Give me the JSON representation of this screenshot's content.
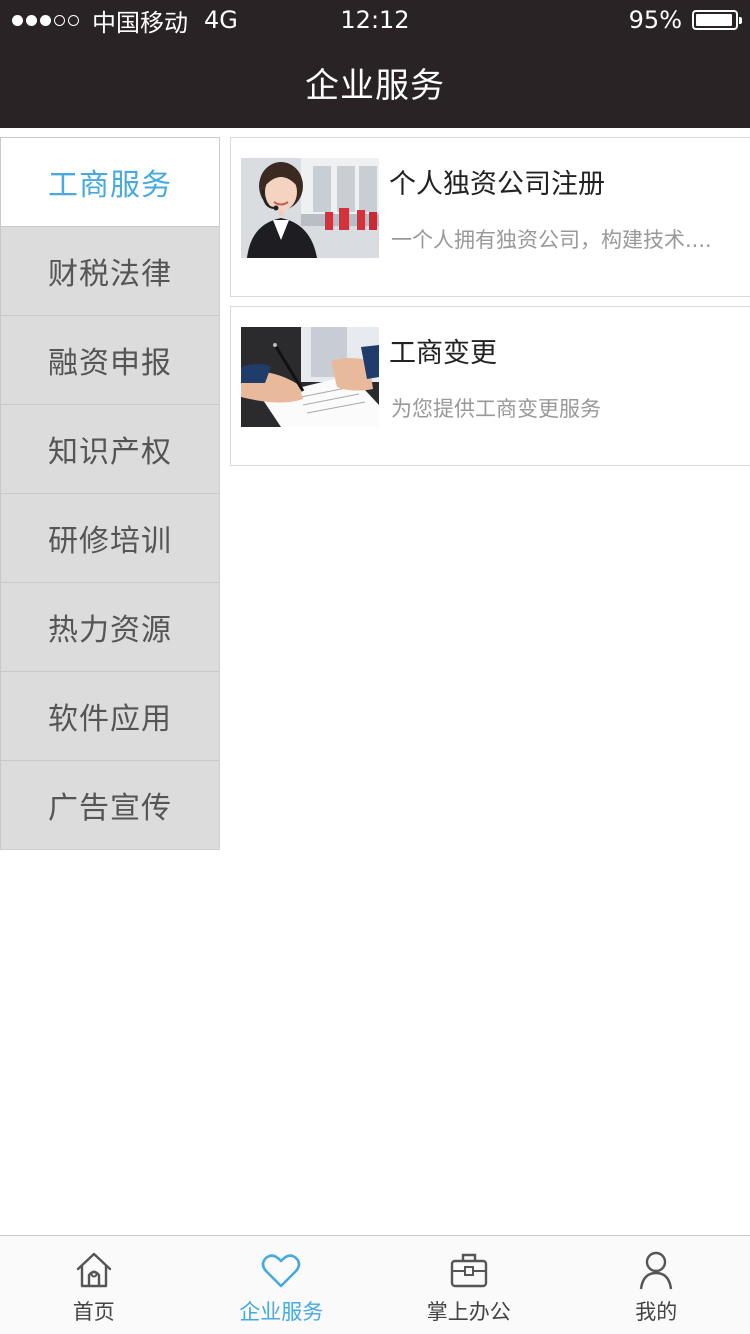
{
  "status_bar": {
    "carrier": "中国移动",
    "network": "4G",
    "time": "12:12",
    "battery": "95%",
    "battery_level": 0.95,
    "signal_bars": 3,
    "signal_total": 5
  },
  "nav": {
    "title": "企业服务"
  },
  "side_menu": {
    "items": [
      {
        "label": "工商服务",
        "active": true
      },
      {
        "label": "财税法律",
        "active": false
      },
      {
        "label": "融资申报",
        "active": false
      },
      {
        "label": "知识产权",
        "active": false
      },
      {
        "label": "研修培训",
        "active": false
      },
      {
        "label": "热力资源",
        "active": false
      },
      {
        "label": "软件应用",
        "active": false
      },
      {
        "label": "广告宣传",
        "active": false
      }
    ]
  },
  "services": [
    {
      "title": "个人独资公司注册",
      "desc": "一个人拥有独资公司，构建技术....",
      "image": "customer-service-photo"
    },
    {
      "title": "工商变更",
      "desc": "为您提供工商变更服务",
      "image": "signing-document-photo"
    }
  ],
  "tab_bar": {
    "tabs": [
      {
        "label": "首页",
        "icon": "home-icon",
        "active": false
      },
      {
        "label": "企业服务",
        "icon": "heart-icon",
        "active": true
      },
      {
        "label": "掌上办公",
        "icon": "briefcase-icon",
        "active": false
      },
      {
        "label": "我的",
        "icon": "user-icon",
        "active": false
      }
    ]
  },
  "colors": {
    "header_bg": "#2a2326",
    "accent": "#47a9de",
    "menu_bg": "#dcdcdc"
  }
}
